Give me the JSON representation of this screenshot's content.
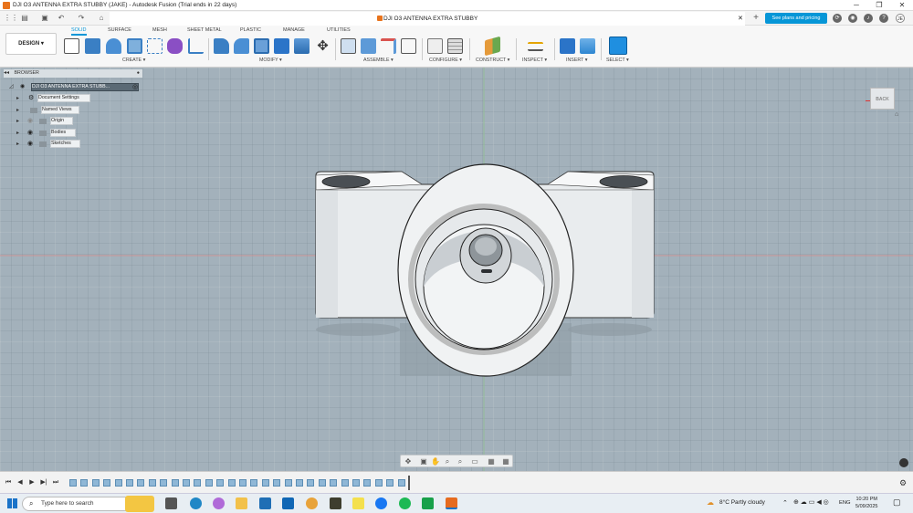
{
  "window": {
    "title": "DJI O3 ANTENNA EXTRA STUBBY (JAKE) - Autodesk Fusion (Trial ends in 22 days)",
    "minimize": "─",
    "maximize": "❐",
    "close": "✕"
  },
  "document_tab": {
    "title": "DJI O3 ANTENNA EXTRA STUBBY",
    "close": "✕",
    "new_tab": "+"
  },
  "header": {
    "plans_button": "See plans and pricing",
    "avatar_initials": "JE"
  },
  "toolbar": {
    "workspace": "DESIGN ▾",
    "tabs": [
      "SOLID",
      "SURFACE",
      "MESH",
      "SHEET METAL",
      "PLASTIC",
      "MANAGE",
      "UTILITIES"
    ],
    "active_tab": "SOLID",
    "groups": [
      "CREATE ▾",
      "MODIFY ▾",
      "ASSEMBLE ▾",
      "CONFIGURE ▾",
      "CONSTRUCT ▾",
      "INSPECT ▾",
      "INSERT ▾",
      "SELECT ▾"
    ]
  },
  "browser": {
    "header": "BROWSER",
    "root": "DJI O3 ANTENNA EXTRA STUBB...",
    "items": [
      "Document Settings",
      "Named Views",
      "Origin",
      "Bodies",
      "Sketches"
    ]
  },
  "viewcube": {
    "label": "BACK"
  },
  "taskbar": {
    "search_placeholder": "Type here to search",
    "weather": "8°C  Partly cloudy",
    "language": "ENG",
    "time": "10:20 PM",
    "date": "5/09/2025"
  },
  "colors": {
    "accent": "#0696d7",
    "viewport": "#a3b1bb",
    "body": "#e9ecee"
  }
}
